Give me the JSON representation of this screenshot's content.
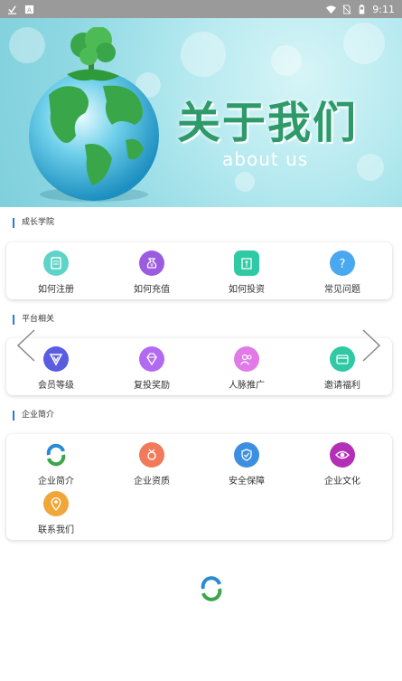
{
  "status_bar": {
    "time": "9:11"
  },
  "banner": {
    "title": "关于我们",
    "subtitle": "about us"
  },
  "sections": [
    {
      "title": "成长学院",
      "items": [
        {
          "label": "如何注册",
          "icon": "register-icon",
          "color": "#5ed4c8"
        },
        {
          "label": "如何充值",
          "icon": "money-bag-icon",
          "color": "#9b5ce0"
        },
        {
          "label": "如何投资",
          "icon": "invest-icon",
          "color": "#2fc9a3"
        },
        {
          "label": "常见问题",
          "icon": "question-icon",
          "color": "#4aa8f0"
        }
      ]
    },
    {
      "title": "平台相关",
      "items": [
        {
          "label": "会员等级",
          "icon": "vip-icon",
          "color": "#5a5de0"
        },
        {
          "label": "复投奖励",
          "icon": "diamond-icon",
          "color": "#b26bf0"
        },
        {
          "label": "人脉推广",
          "icon": "people-icon",
          "color": "#e07ae6"
        },
        {
          "label": "邀请福利",
          "icon": "card-icon",
          "color": "#2fc9a3"
        }
      ]
    },
    {
      "title": "企业简介",
      "items": [
        {
          "label": "企业简介",
          "icon": "company-logo-icon",
          "color": "#2a8bd3"
        },
        {
          "label": "企业资质",
          "icon": "medal-icon",
          "color": "#f07a5a"
        },
        {
          "label": "安全保障",
          "icon": "shield-icon",
          "color": "#3a8fe0"
        },
        {
          "label": "企业文化",
          "icon": "eye-icon",
          "color": "#b42fb8"
        },
        {
          "label": "联系我们",
          "icon": "location-icon",
          "color": "#f0a73a"
        }
      ]
    }
  ]
}
